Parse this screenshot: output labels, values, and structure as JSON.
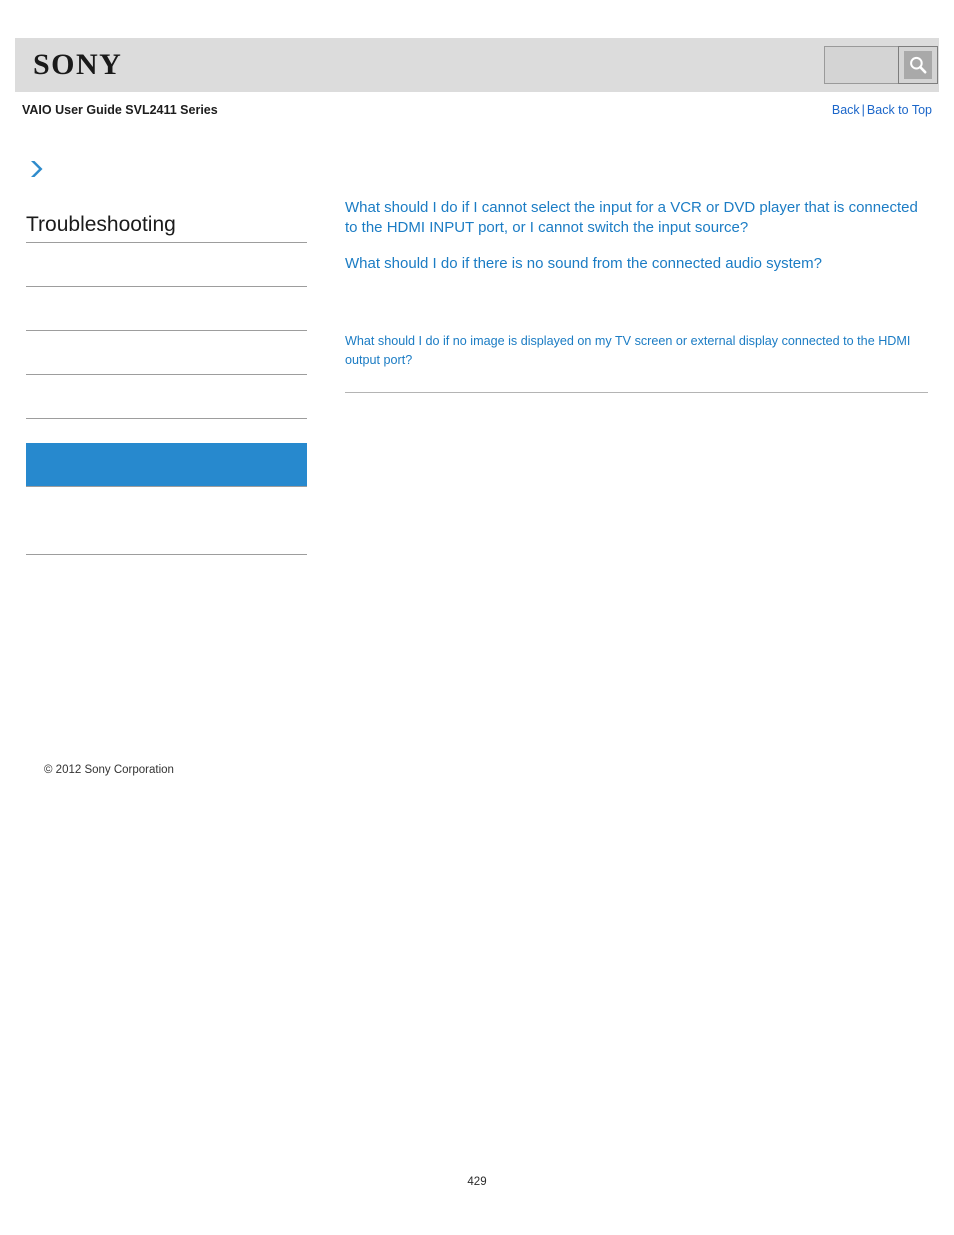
{
  "header": {
    "brand_logo_text": "SONY",
    "background_color": "#dcdcdc",
    "search": {
      "value": "",
      "placeholder": "",
      "button_icon": "search-icon"
    }
  },
  "subheader": {
    "doc_title": "VAIO User Guide SVL2411 Series",
    "nav": {
      "back_label": "Back",
      "separator": "|",
      "back_to_top_label": "Back to Top"
    }
  },
  "sidebar": {
    "breadcrumb_icon": "chevron-right-icon",
    "accent_color": "#2789ce",
    "title": "Troubleshooting",
    "items": [
      {
        "label": "",
        "selected": false
      },
      {
        "label": "",
        "selected": false
      },
      {
        "label": "",
        "selected": false
      },
      {
        "label": "",
        "selected": false
      },
      {
        "label": "",
        "selected": true
      },
      {
        "label": "",
        "selected": false
      }
    ],
    "copyright": "© 2012 Sony Corporation"
  },
  "content": {
    "link_color": "#1b7cc4",
    "links": [
      {
        "text": "What should I do if I cannot select the input for a VCR or DVD player that is connected to the HDMI INPUT port, or I cannot switch the input source?",
        "size": "normal"
      },
      {
        "text": "What should I do if there is no sound from the connected audio system?",
        "size": "normal"
      },
      {
        "text": "What should I do if no image is displayed on my TV screen or external display connected to the HDMI output port?",
        "size": "small"
      }
    ]
  },
  "footer": {
    "page_number": "429"
  }
}
